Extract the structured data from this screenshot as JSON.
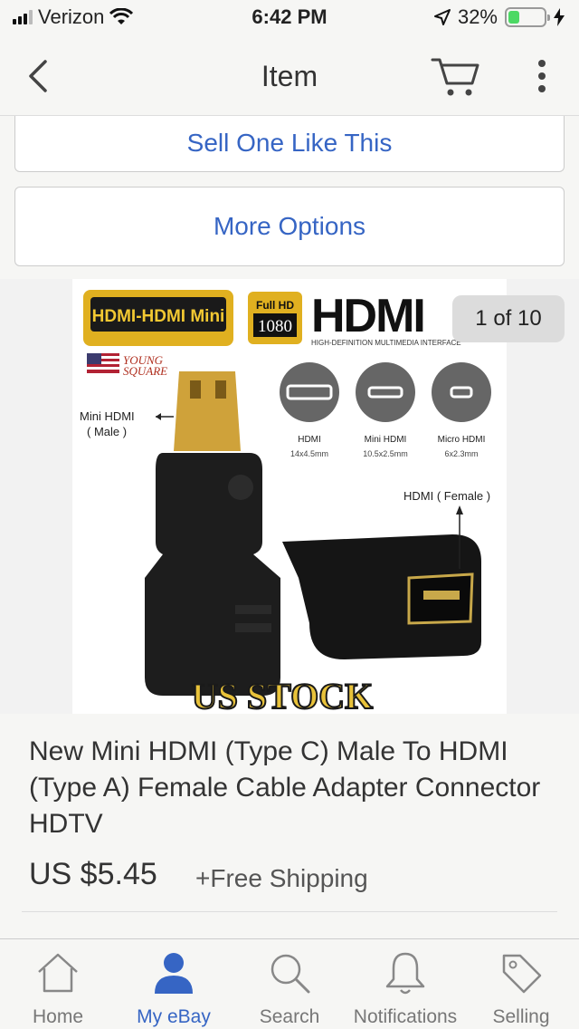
{
  "status_bar": {
    "carrier": "Verizon",
    "time": "6:42 PM",
    "battery": "32%",
    "battery_level": 0.32
  },
  "nav": {
    "title": "Item",
    "icons": [
      "back-icon",
      "cart-icon",
      "more-icon"
    ]
  },
  "actions": {
    "sell_one": "Sell One Like This",
    "more_options": "More Options"
  },
  "gallery": {
    "counter": "1 of 10",
    "image": {
      "badge": "HDMI-HDMI Mini",
      "full_hd": "Full HD",
      "res": "1080",
      "logo": "HDMI",
      "logo_sub": "HIGH-DEFINITION MULTIMEDIA INTERFACE",
      "brand_line1": "YOUNG",
      "brand_line2": "SQUARE",
      "mini_label": "Mini HDMI",
      "mini_label2": "( Male )",
      "female_label": "HDMI ( Female )",
      "port_types": [
        {
          "name": "HDMI",
          "size": "14x4.5mm"
        },
        {
          "name": "Mini HDMI",
          "size": "10.5x2.5mm"
        },
        {
          "name": "Micro HDMI",
          "size": "6x2.3mm"
        }
      ],
      "stock": "US STOCK"
    }
  },
  "product": {
    "title": "New Mini HDMI (Type C) Male To HDMI (Type A) Female Cable Adapter Connector HDTV",
    "price": "US $5.45",
    "shipping": "+Free Shipping"
  },
  "tabs": [
    {
      "label": "Home",
      "icon": "home-icon",
      "active": false
    },
    {
      "label": "My eBay",
      "icon": "user-icon",
      "active": true
    },
    {
      "label": "Search",
      "icon": "search-icon",
      "active": false
    },
    {
      "label": "Notifications",
      "icon": "bell-icon",
      "active": false
    },
    {
      "label": "Selling",
      "icon": "tag-icon",
      "active": false
    }
  ],
  "colors": {
    "accent": "#3665c4",
    "background": "#f6f6f4"
  }
}
